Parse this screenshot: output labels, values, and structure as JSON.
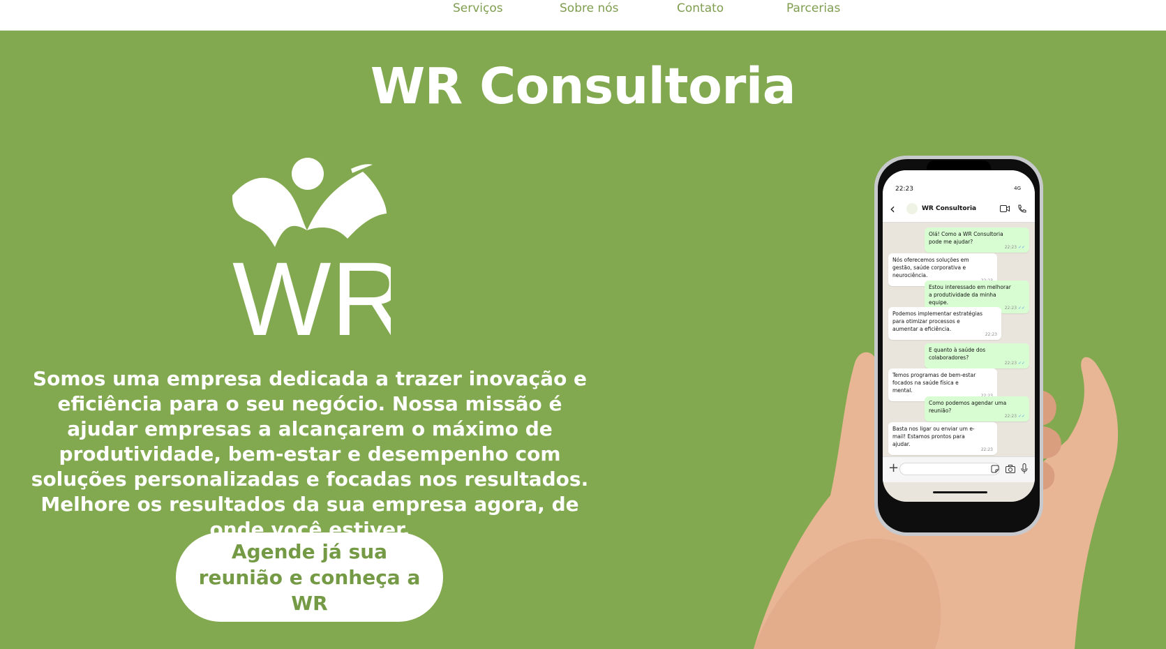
{
  "nav": {
    "items": [
      {
        "label": "Serviços"
      },
      {
        "label": "Sobre nós"
      },
      {
        "label": "Contato"
      },
      {
        "label": "Parcerias"
      }
    ]
  },
  "hero": {
    "title": "WR Consultoria",
    "logo_text": "WR",
    "description": "Somos uma empresa dedicada a trazer inovação e eficiência para o seu negócio. Nossa missão é ajudar empresas a alcançarem o máximo de produtividade, bem-estar e desempenho com soluções personalizadas e focadas nos resultados. Melhore os resultados da sua empresa agora, de onde você estiver.",
    "cta_label": "Agende já sua reunião e conheça a WR"
  },
  "phone": {
    "status_time": "22:23",
    "status_signal": "4G",
    "contact_name": "WR Consultoria",
    "messages": [
      {
        "direction": "out",
        "text": "Olá! Como a WR Consultoria pode me ajudar?",
        "time": "22:23"
      },
      {
        "direction": "in",
        "text": "Nós oferecemos soluções em gestão, saúde corporativa e neurociência.",
        "time": "22:23"
      },
      {
        "direction": "out",
        "text": "Estou interessado em melhorar a produtividade da minha equipe.",
        "time": "22:23"
      },
      {
        "direction": "in",
        "text": "Podemos implementar estratégias para otimizar processos e aumentar a eficiência.",
        "time": "22:23"
      },
      {
        "direction": "out",
        "text": "E quanto à saúde dos colaboradores?",
        "time": "22:23"
      },
      {
        "direction": "in",
        "text": "Temos programas de bem-estar focados na saúde física e mental.",
        "time": "22:23"
      },
      {
        "direction": "out",
        "text": "Como podemos agendar uma reunião?",
        "time": "22:23"
      },
      {
        "direction": "in",
        "text": "Basta nos ligar ou enviar um e-mail! Estamos prontos para ajudar.",
        "time": "22:23"
      }
    ]
  },
  "colors": {
    "brand_green": "#82a94f",
    "nav_text": "#7f9e4f",
    "button_text": "#759a45",
    "white": "#ffffff"
  },
  "icons": {
    "logo": "wr-logo-icon",
    "back": "chevron-left-icon",
    "video": "video-camera-icon",
    "call": "phone-icon",
    "attach": "plus-icon",
    "sticker": "sticker-icon",
    "camera": "camera-icon",
    "mic": "microphone-icon"
  }
}
